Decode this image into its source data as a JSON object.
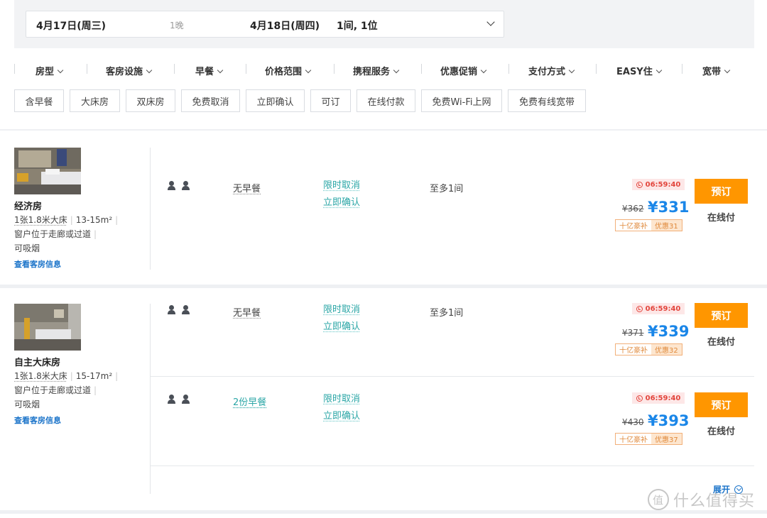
{
  "search": {
    "checkin": "4月17日(周三)",
    "nights": "1晚",
    "checkout": "4月18日(周四)",
    "guests": "1间, 1位"
  },
  "filters": [
    "房型",
    "客房设施",
    "早餐",
    "价格范围",
    "携程服务",
    "优惠促销",
    "支付方式",
    "EASY住",
    "宽带"
  ],
  "tags": [
    "含早餐",
    "大床房",
    "双床房",
    "免费取消",
    "立即确认",
    "可订",
    "在线付款",
    "免费Wi-Fi上网",
    "免费有线宽带"
  ],
  "rooms": [
    {
      "name": "经济房",
      "bed": "1张1.8米大床",
      "area": "13-15m²",
      "window": "窗户位于走廊或过道",
      "smoking": "可吸烟",
      "link": "查看客房信息",
      "offers": [
        {
          "meal": "无早餐",
          "cancel": "限时取消",
          "confirm": "立即确认",
          "max": "至多1间",
          "timer": "06:59:40",
          "old_price": "¥362",
          "price": "¥331",
          "badge_a": "十亿豪补",
          "badge_b": "优惠31",
          "book": "预订",
          "pay": "在线付"
        }
      ]
    },
    {
      "name": "自主大床房",
      "bed": "1张1.8米大床",
      "area": "15-17m²",
      "window": "窗户位于走廊或过道",
      "smoking": "可吸烟",
      "link": "查看客房信息",
      "offers": [
        {
          "meal": "无早餐",
          "cancel": "限时取消",
          "confirm": "立即确认",
          "max": "至多1间",
          "timer": "06:59:40",
          "old_price": "¥371",
          "price": "¥339",
          "badge_a": "十亿豪补",
          "badge_b": "优惠32",
          "book": "预订",
          "pay": "在线付"
        },
        {
          "meal": "2份早餐",
          "cancel": "限时取消",
          "confirm": "立即确认",
          "max": "",
          "timer": "06:59:40",
          "old_price": "¥430",
          "price": "¥393",
          "badge_a": "十亿豪补",
          "badge_b": "优惠37",
          "book": "预订",
          "pay": "在线付"
        }
      ]
    }
  ],
  "expand_label": "展开",
  "watermark": "什么值得买"
}
